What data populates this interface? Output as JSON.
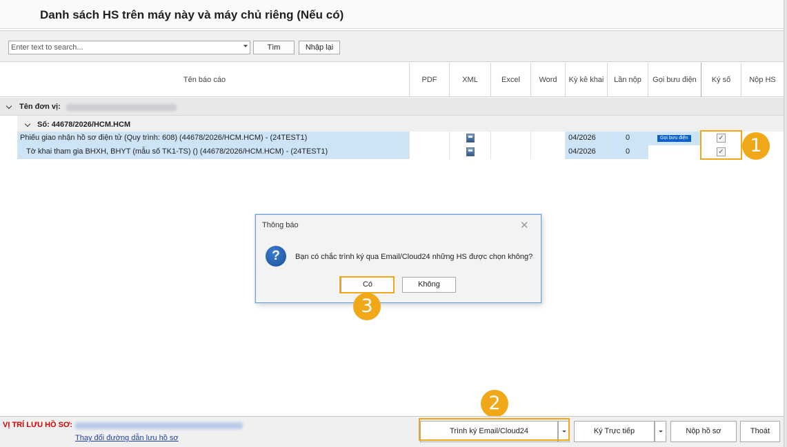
{
  "title": "Danh sách HS trên máy này và máy chủ riêng (Nếu có)",
  "search": {
    "placeholder": "Enter text to search...",
    "find_label": "Tìm",
    "reset_label": "Nhập lại"
  },
  "grid": {
    "columns": [
      "Tên báo cáo",
      "PDF",
      "XML",
      "Excel",
      "Word",
      "Kỳ kê khai",
      "Lần nộp",
      "Gọi bưu điện",
      "Ký số",
      "Nộp HS"
    ],
    "unit_group_label": "Tên đơn vị:",
    "doc_group_label": "Số: 44678/2026/HCM.HCM",
    "rows": [
      {
        "name": "Phiếu giao nhận hồ sơ điện tử (Quy trình: 608) (44678/2026/HCM.HCM) - (24TEST1)",
        "period": "04/2026",
        "submits": "0",
        "post_badge": "Gọi bưu điện",
        "signed_mark": "✓"
      },
      {
        "name": "Tờ khai tham gia BHXH, BHYT (mẫu số TK1-TS) () (44678/2026/HCM.HCM) - (24TEST1)",
        "period": "04/2026",
        "submits": "0",
        "post_badge": "",
        "signed_mark": "✓"
      }
    ]
  },
  "dialog": {
    "title": "Thông báo",
    "close_glyph": "✕",
    "icon_glyph": "?",
    "message": "Bạn có chắc trình ký qua Email/Cloud24  những HS được chọn không?",
    "yes_label": "Có",
    "no_label": "Không"
  },
  "bottom": {
    "location_label": "VỊ TRÍ LƯU HỒ SƠ:",
    "change_path_link": "Thay đổi đường dẫn lưu hồ sơ",
    "sign_email_label": "Trình ký Email/Cloud24",
    "sign_direct_label": "Ký Trực tiếp",
    "submit_label": "Nộp hồ sơ",
    "exit_label": "Thoát"
  },
  "callouts": [
    "1",
    "2",
    "3"
  ],
  "colors": {
    "accent": "#f0a818",
    "selected_row": "#cde3f6",
    "location_red": "#d40000",
    "link_blue": "#1f3fa8",
    "badge_blue": "#0b5fc9"
  }
}
